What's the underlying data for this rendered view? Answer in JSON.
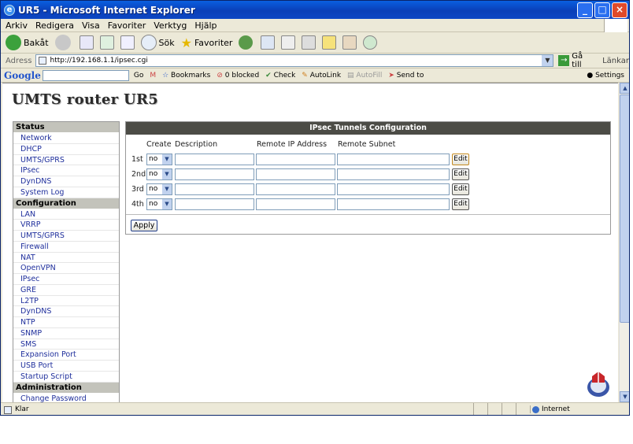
{
  "window": {
    "title": "UR5 - Microsoft Internet Explorer",
    "controls": {
      "minimize": "_",
      "maximize": "□",
      "close": "×"
    }
  },
  "menu": [
    "Arkiv",
    "Redigera",
    "Visa",
    "Favoriter",
    "Verktyg",
    "Hjälp"
  ],
  "toolbar": {
    "back_label": "Bakåt",
    "search_label": "Sök",
    "favorites_label": "Favoriter"
  },
  "address": {
    "label": "Adress",
    "url": "http://192.168.1.1/ipsec.cgi",
    "go_label": "Gå till",
    "links_label": "Länkar"
  },
  "google_toolbar": {
    "logo": "Google",
    "go_label": "Go",
    "bookmarks_label": "Bookmarks",
    "blocked_label": "0 blocked",
    "check_label": "Check",
    "autolink_label": "AutoLink",
    "autofill_label": "AutoFill",
    "sendto_label": "Send to",
    "settings_label": "Settings"
  },
  "page": {
    "title": "UMTS router UR5"
  },
  "sidebar": {
    "status_header": "Status",
    "status_items": [
      "Network",
      "DHCP",
      "UMTS/GPRS",
      "IPsec",
      "DynDNS",
      "System Log"
    ],
    "config_header": "Configuration",
    "config_items": [
      "LAN",
      "VRRP",
      "UMTS/GPRS",
      "Firewall",
      "NAT",
      "OpenVPN",
      "IPsec",
      "GRE",
      "L2TP",
      "DynDNS",
      "NTP",
      "SNMP",
      "SMS",
      "Expansion Port",
      "USB Port",
      "Startup Script"
    ],
    "admin_header": "Administration",
    "admin_items": [
      "Change Password"
    ]
  },
  "ipsec": {
    "header": "IPsec Tunnels Configuration",
    "columns": {
      "create": "Create",
      "description": "Description",
      "remote_ip": "Remote IP Address",
      "remote_subnet": "Remote Subnet"
    },
    "rows": [
      {
        "label": "1st",
        "create": "no",
        "description": "",
        "remote_ip": "",
        "remote_subnet": "",
        "edit": "Edit"
      },
      {
        "label": "2nd",
        "create": "no",
        "description": "",
        "remote_ip": "",
        "remote_subnet": "",
        "edit": "Edit"
      },
      {
        "label": "3rd",
        "create": "no",
        "description": "",
        "remote_ip": "",
        "remote_subnet": "",
        "edit": "Edit"
      },
      {
        "label": "4th",
        "create": "no",
        "description": "",
        "remote_ip": "",
        "remote_subnet": "",
        "edit": "Edit"
      }
    ],
    "apply_label": "Apply"
  },
  "status_bar": {
    "status": "Klar",
    "zone": "Internet"
  }
}
